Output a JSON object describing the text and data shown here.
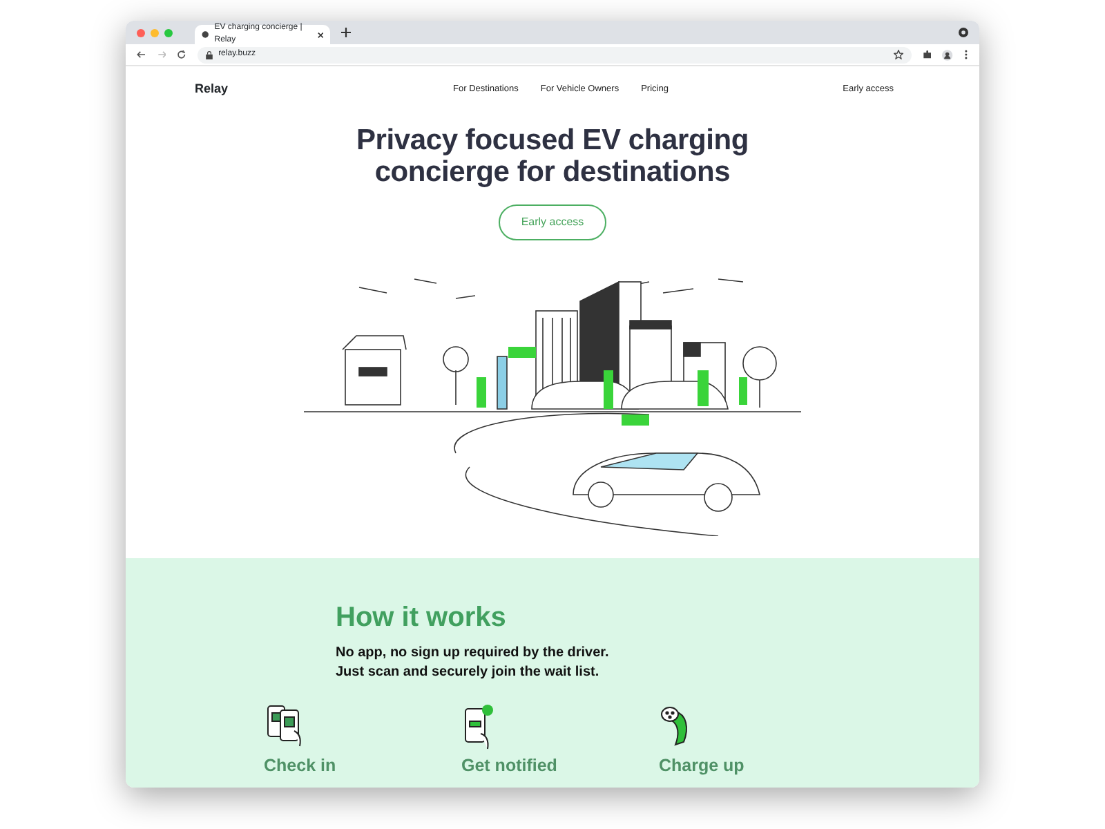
{
  "browser": {
    "tab_title": "EV charging concierge | Relay",
    "url": "relay.buzz"
  },
  "nav": {
    "logo": "Relay",
    "links": [
      "For Destinations",
      "For Vehicle Owners",
      "Pricing"
    ],
    "cta": "Early access"
  },
  "hero": {
    "title_lines": [
      "Privacy focused EV charging",
      "concierge for destinations"
    ],
    "button": "Early access"
  },
  "how_it_works": {
    "title": "How it works",
    "subtitle_lines": [
      "No app, no sign up required by the driver.",
      "Just scan and securely join the wait list."
    ],
    "steps": [
      {
        "kind": "checkin",
        "label": "Check in"
      },
      {
        "kind": "notify",
        "label": "Get notified"
      },
      {
        "kind": "charge",
        "label": "Charge up"
      }
    ]
  }
}
